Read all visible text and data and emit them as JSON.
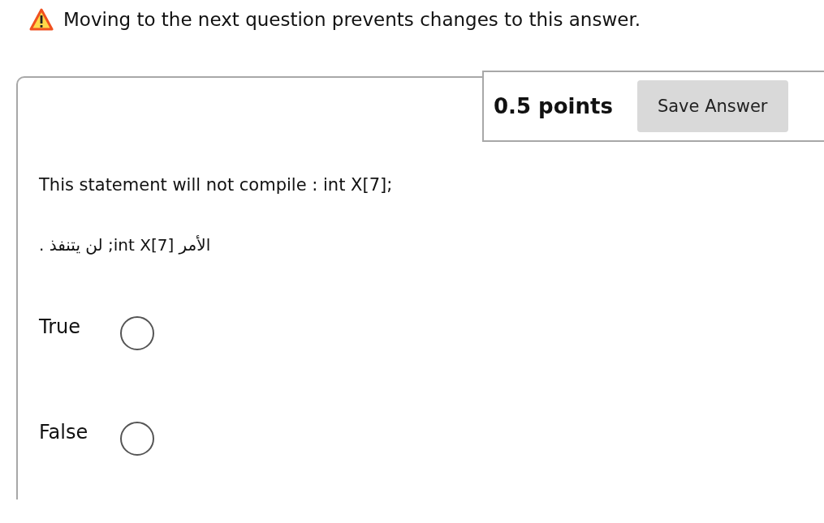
{
  "warning": {
    "text": "Moving to the next question prevents changes to this answer."
  },
  "question": {
    "points": "0.5 points",
    "save_button": "Save Answer",
    "text": "This statement will not compile : int X[7];",
    "text_arabic": "الأمر int X[7]; لن يتنفذ .",
    "options": [
      {
        "label": "True",
        "selected": false
      },
      {
        "label": "False",
        "selected": false
      }
    ]
  }
}
